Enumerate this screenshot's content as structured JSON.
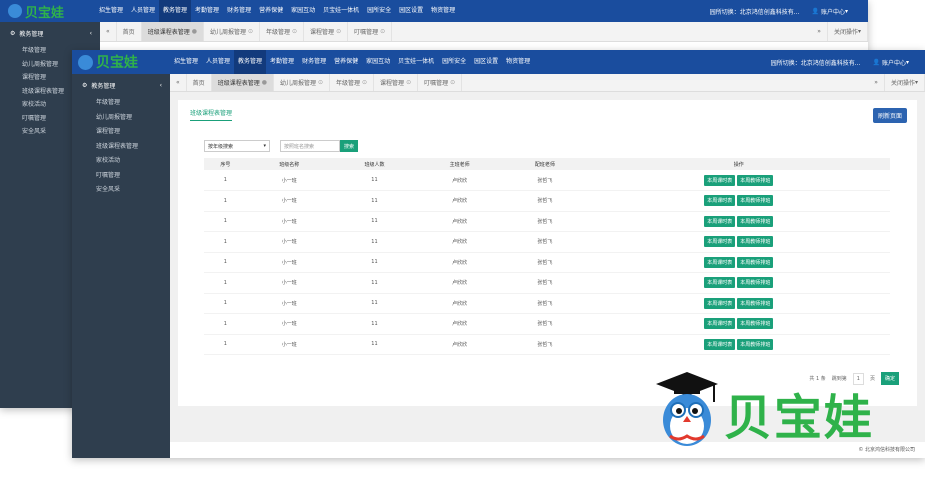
{
  "brand": {
    "name": "贝宝娃"
  },
  "nav": {
    "items": [
      "招生管理",
      "人员管理",
      "教务管理",
      "考勤管理",
      "财务管理",
      "营养保健",
      "家园互动",
      "贝宝娃一体机",
      "园所安全",
      "园区设置",
      "物资管理"
    ],
    "active_index": 2,
    "switch_label_back": "园所切换：北京鸿信创鑫科技有...",
    "switch_label_front": "园所切换：北京鸿信创鑫科技有...",
    "account": "账户中心"
  },
  "sidebar": {
    "head": "教务管理",
    "items": [
      "年级管理",
      "幼儿周报管理",
      "课程管理",
      "班级课程表管理",
      "家校活动",
      "叮嘱管理",
      "安全风采"
    ]
  },
  "tabs_back": {
    "home": "首页",
    "items": [
      "班级课程表管理",
      "幼儿周报管理",
      "年级管理",
      "课程管理",
      "叮嘱管理"
    ],
    "close_ops": "关闭操作"
  },
  "tabs_front": {
    "home": "首页",
    "items": [
      "班级课程表管理",
      "幼儿周报管理",
      "年级管理",
      "课程管理",
      "叮嘱管理"
    ],
    "close_ops": "关闭操作"
  },
  "panel": {
    "title": "班级课程表管理",
    "refresh": "刷新页面",
    "filter_select": "按年级搜索",
    "filter_placeholder": "按照班名搜索",
    "search": "搜索"
  },
  "table": {
    "headers": [
      "序号",
      "班级名称",
      "班级人数",
      "主班老师",
      "配班老师",
      "操作"
    ],
    "rows": [
      [
        "1",
        "小一班",
        "11",
        "卢欣欣",
        "张哲飞"
      ],
      [
        "1",
        "小一班",
        "11",
        "卢欣欣",
        "张哲飞"
      ],
      [
        "1",
        "小一班",
        "11",
        "卢欣欣",
        "张哲飞"
      ],
      [
        "1",
        "小一班",
        "11",
        "卢欣欣",
        "张哲飞"
      ],
      [
        "1",
        "小一班",
        "11",
        "卢欣欣",
        "张哲飞"
      ],
      [
        "1",
        "小一班",
        "11",
        "卢欣欣",
        "张哲飞"
      ],
      [
        "1",
        "小一班",
        "11",
        "卢欣欣",
        "张哲飞"
      ],
      [
        "1",
        "小一班",
        "11",
        "卢欣欣",
        "张哲飞"
      ],
      [
        "1",
        "小一班",
        "11",
        "卢欣欣",
        "张哲飞"
      ]
    ],
    "action1": "本周课时表",
    "action2": "本周教师排班"
  },
  "pager": {
    "total": "共 1 条",
    "goto": "跳到第",
    "page": "1",
    "unit": "页",
    "confirm": "确定"
  },
  "footer": "© 北京鸿信科技有限公司",
  "colors": {
    "nav": "#1a4d9e",
    "sidebar": "#2f3e4e",
    "accent": "#1aa07a",
    "brand": "#2fb24a"
  }
}
